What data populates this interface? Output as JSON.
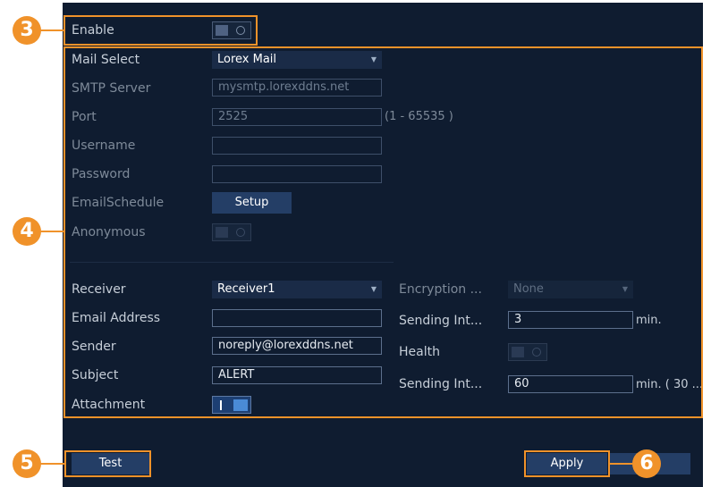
{
  "enable": {
    "label": "Enable"
  },
  "form_left": {
    "mail_select": {
      "label": "Mail Select",
      "value": "Lorex Mail"
    },
    "smtp_server": {
      "label": "SMTP Server",
      "value": "mysmtp.lorexddns.net"
    },
    "port": {
      "label": "Port",
      "value": "2525",
      "hint": "(1 - 65535 )"
    },
    "username": {
      "label": "Username",
      "value": ""
    },
    "password": {
      "label": "Password",
      "value": ""
    },
    "email_schedule": {
      "label": "EmailSchedule",
      "button": "Setup"
    },
    "anonymous": {
      "label": "Anonymous"
    }
  },
  "form_lower": {
    "receiver": {
      "label": "Receiver",
      "value": "Receiver1"
    },
    "email_address": {
      "label": "Email Address",
      "value": ""
    },
    "sender": {
      "label": "Sender",
      "value": "noreply@lorexddns.net"
    },
    "subject": {
      "label": "Subject",
      "value": "ALERT"
    },
    "attachment": {
      "label": "Attachment"
    }
  },
  "form_right": {
    "encryption": {
      "label": "Encryption ...",
      "value": "None"
    },
    "sending_interval": {
      "label": "Sending Int...",
      "value": "3",
      "unit": "min."
    },
    "health": {
      "label": "Health"
    },
    "health_interval": {
      "label": "Sending Int...",
      "value": "60",
      "unit": "min. ( 30 ..."
    }
  },
  "buttons": {
    "test": "Test",
    "apply": "Apply"
  },
  "callouts": {
    "c3": "3",
    "c4": "4",
    "c5": "5",
    "c6": "6"
  },
  "colors": {
    "panel_bg": "#0f1c30",
    "accent_orange": "#f0922a",
    "button_blue": "#243e66"
  }
}
